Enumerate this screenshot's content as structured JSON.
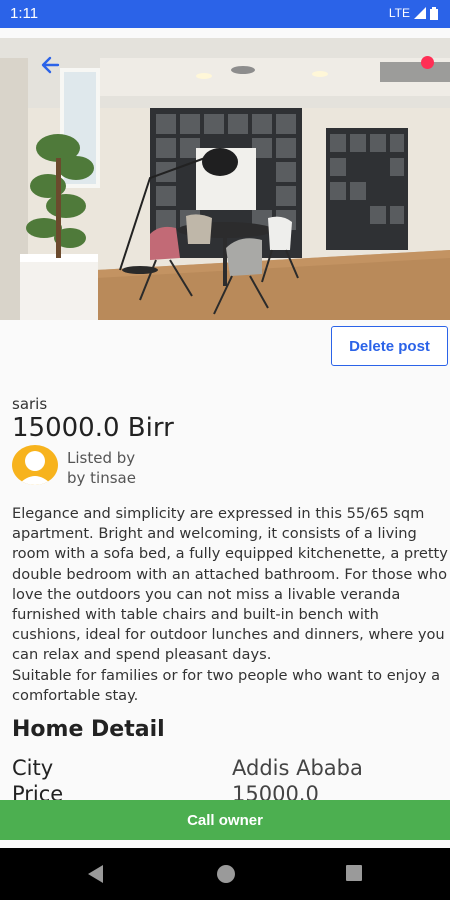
{
  "status_bar": {
    "time": "1:11",
    "network": "LTE"
  },
  "listing": {
    "title": "saris",
    "price": "15000.0 Birr",
    "listed_by_label": "Listed by",
    "lister": "by tinsae",
    "description": "Elegance and simplicity are expressed in this 55/65 sqm apartment. Bright and welcoming, it consists of a living room with a sofa bed, a fully equipped kitchenette, a pretty double bedroom with an attached bathroom. For those who love the outdoors you can not miss a livable veranda furnished with table chairs and built-in bench with cushions, ideal for outdoor lunches and dinners, where you can relax and spend pleasant days.\nSuitable for families or for two people who want to enjoy a comfortable stay."
  },
  "actions": {
    "delete_label": "Delete post",
    "call_label": "Call owner"
  },
  "home_detail": {
    "heading": "Home Detail",
    "rows": [
      {
        "label": "City",
        "value": "Addis Ababa"
      },
      {
        "label": "Price",
        "value": "15000.0"
      }
    ]
  },
  "icons": {
    "back": "arrow-left-icon",
    "notification": "red-dot-icon",
    "signal": "signal-icon",
    "battery": "battery-icon",
    "nav_back": "triangle-back-icon",
    "nav_home": "circle-home-icon",
    "nav_recents": "square-recents-icon"
  },
  "colors": {
    "accent": "#2b63e8",
    "call": "#4caf50",
    "avatar": "#f7b31d",
    "badge": "#ff2f55"
  }
}
